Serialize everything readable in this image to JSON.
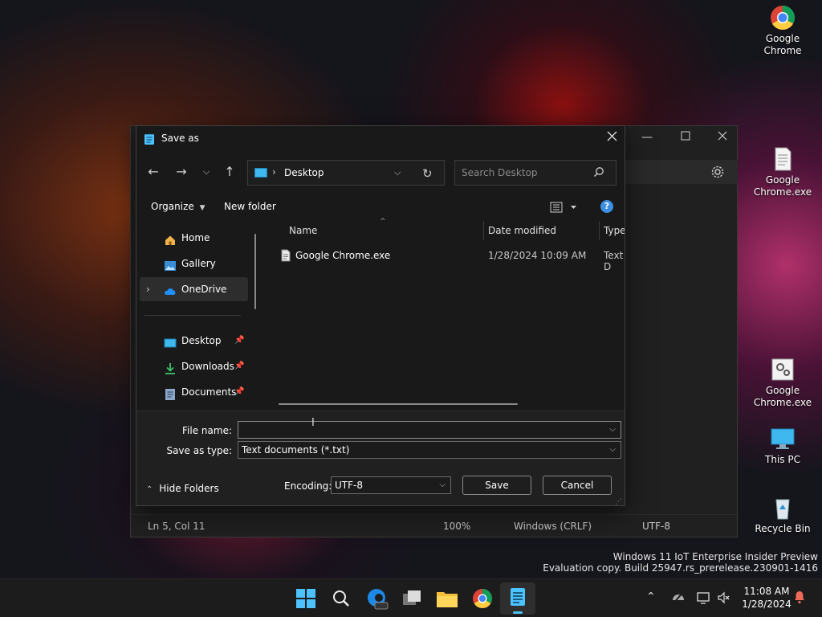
{
  "desktop": {
    "icons": [
      {
        "label": "Google Chrome",
        "icon": "chrome-icon"
      },
      {
        "label": "Google Chrome.exe",
        "icon": "text-file-icon"
      },
      {
        "label": "Google Chrome.exe",
        "icon": "settings-file-icon"
      },
      {
        "label": "This PC",
        "icon": "monitor-icon"
      },
      {
        "label": "Recycle Bin",
        "icon": "recycle-bin-icon"
      }
    ],
    "watermark_line1": "Windows 11 IoT Enterprise Insider Preview",
    "watermark_line2": "Evaluation copy. Build 25947.rs_prerelease.230901-1416"
  },
  "notepad": {
    "status": {
      "position": "Ln 5, Col 11",
      "zoom": "100%",
      "line_ending": "Windows (CRLF)",
      "encoding": "UTF-8"
    }
  },
  "dialog": {
    "title": "Save as",
    "address": {
      "location": "Desktop"
    },
    "search_placeholder": "Search Desktop",
    "commands": {
      "organize": "Organize",
      "new_folder": "New folder"
    },
    "nav": {
      "items": [
        {
          "label": "Home",
          "icon": "home-icon"
        },
        {
          "label": "Gallery",
          "icon": "gallery-icon"
        },
        {
          "label": "OneDrive",
          "icon": "onedrive-icon"
        },
        {
          "label": "Desktop",
          "icon": "desktop-folder-icon"
        },
        {
          "label": "Downloads",
          "icon": "downloads-icon"
        },
        {
          "label": "Documents",
          "icon": "documents-icon"
        }
      ]
    },
    "columns": {
      "name": "Name",
      "date": "Date modified",
      "type": "Type"
    },
    "files": [
      {
        "name": "Google Chrome.exe",
        "date": "1/28/2024 10:09 AM",
        "type": "Text D"
      }
    ],
    "form": {
      "file_name_label": "File name:",
      "file_name_value": "",
      "type_label": "Save as type:",
      "type_value": "Text documents (*.txt)",
      "encoding_label": "Encoding:",
      "encoding_value": "UTF-8",
      "hide_folders": "Hide Folders",
      "save": "Save",
      "cancel": "Cancel"
    }
  },
  "taskbar": {
    "apps": [
      "start-icon",
      "search-icon",
      "edge-preview-icon",
      "task-view-icon",
      "file-explorer-icon",
      "chrome-icon",
      "notepad-icon"
    ],
    "clock": {
      "time": "11:08 AM",
      "date": "1/28/2024"
    }
  },
  "colors": {
    "accent": "#4cc2ff",
    "help": "#3b8fe0"
  }
}
